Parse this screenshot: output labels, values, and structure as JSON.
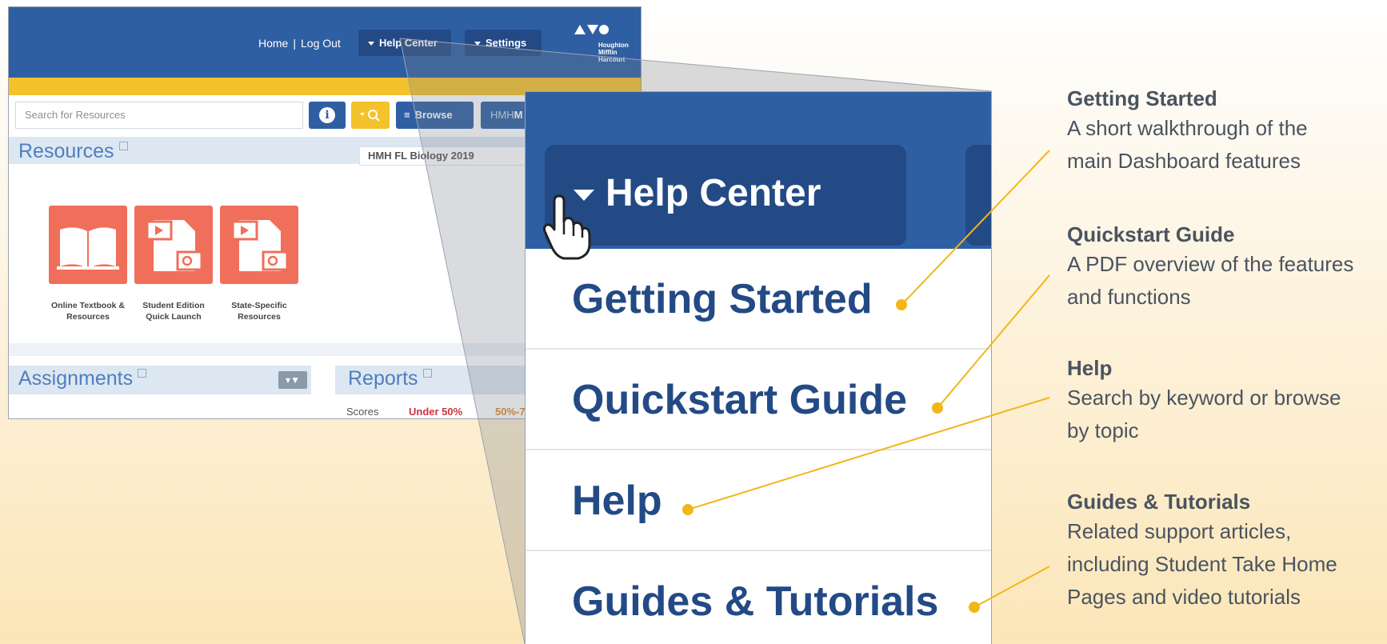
{
  "dashboard": {
    "nav": {
      "home": "Home",
      "separator": "|",
      "logout": "Log Out",
      "help_center": "Help Center",
      "settings": "Settings"
    },
    "logo": {
      "line1": "Houghton",
      "line2": "Mifflin",
      "line3": "Harcourt"
    },
    "search": {
      "placeholder": "Search for Resources"
    },
    "browse_label": "Browse",
    "hmh_prefix": "HMH",
    "hmh_bold": "M",
    "resources_title": "Resources",
    "course_name": "HMH FL Biology 2019",
    "tiles": [
      {
        "line1": "Online Textbook &",
        "line2": "Resources",
        "icon": "open-book-icon"
      },
      {
        "line1": "Student Edition",
        "line2": "Quick Launch",
        "icon": "video-document-icon"
      },
      {
        "line1": "State-Specific",
        "line2": "Resources",
        "icon": "video-document-icon"
      }
    ],
    "assignments_title": "Assignments",
    "reports_title": "Reports",
    "scores": {
      "label": "Scores",
      "under50": "Under 50%",
      "range": "50%-7"
    },
    "colors": {
      "brand_blue": "#2f5fa3",
      "accent_yellow": "#f4c22b",
      "tile_coral": "#f06f5a"
    }
  },
  "zoom": {
    "help_center": "Help Center",
    "menu": [
      "Getting Started",
      "Quickstart Guide",
      "Help",
      "Guides & Tutorials"
    ]
  },
  "callouts": [
    {
      "title": "Getting Started",
      "body_line1": "A short walkthrough of the",
      "body_line2": "main Dashboard features"
    },
    {
      "title": "Quickstart Guide",
      "body_line1": "A PDF overview of the features",
      "body_line2": "and functions"
    },
    {
      "title": "Help",
      "body_line1": "Search by keyword or browse",
      "body_line2": "by topic"
    },
    {
      "title": "Guides & Tutorials",
      "body_line1": "Related support articles,",
      "body_line2": "including Student Take Home",
      "body_line3": "Pages and video tutorials"
    }
  ]
}
